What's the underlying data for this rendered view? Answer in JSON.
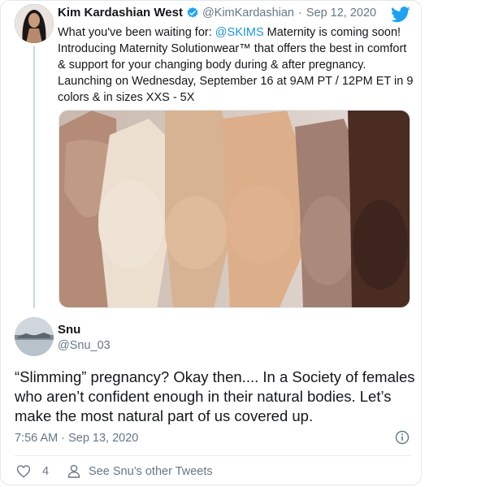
{
  "original_tweet": {
    "author_name": "Kim Kardashian West",
    "handle": "@KimKardashian",
    "separator": "·",
    "date": "Sep 12, 2020",
    "text_before_mention": "What you've been waiting for: ",
    "mention": "@SKIMS",
    "text_after_mention": " Maternity is coming soon! Introducing Maternity Solutionwear™ that offers the best in comfort & support for your changing body during & after pregnancy. Launching on Wednesday, September 16 at 9AM PT / 12PM ET in 9 colors & in sizes XXS - 5X",
    "icons": {
      "verified": "verified-badge-icon",
      "brand": "twitter-bird-icon"
    },
    "colors": {
      "link": "#1b95e0",
      "verified": "#1da1f2"
    }
  },
  "reply": {
    "author_name": "Snu",
    "handle": "@Snu_03",
    "text": "“Slimming” pregnancy? Okay then.... In a Society of females who aren’t confident enough in their natural bodies. Let’s make the most natural part of us covered up.",
    "timestamp": "7:56 AM · Sep 13, 2020",
    "like_count": "4",
    "see_more_label": "See Snu’s other Tweets",
    "icons": {
      "info": "info-icon",
      "like": "heart-icon",
      "profile": "person-icon"
    }
  }
}
